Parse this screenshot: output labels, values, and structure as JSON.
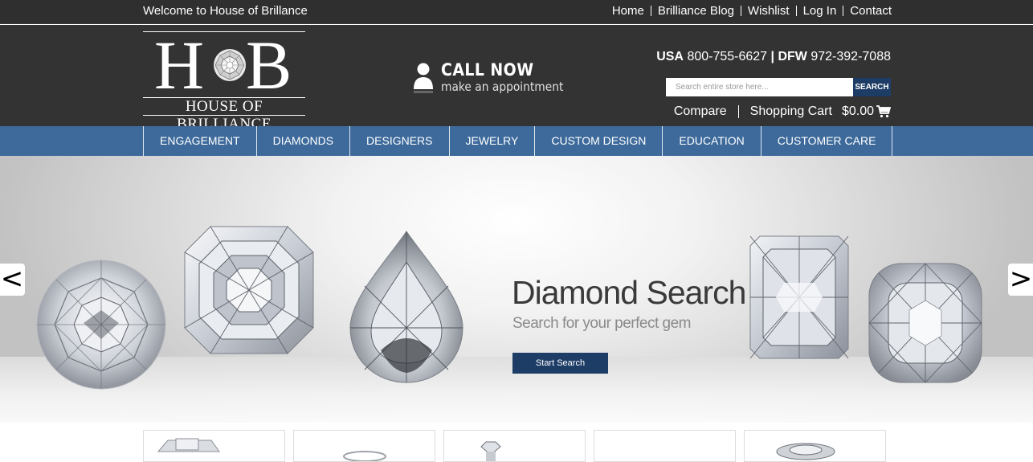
{
  "topbar": {
    "welcome": "Welcome to House of Brillance",
    "links": [
      "Home",
      "Brilliance Blog",
      "Wishlist",
      "Log In",
      "Contact"
    ]
  },
  "logo": {
    "letter_left": "H",
    "letter_right": "B",
    "wordmark": "HOUSE OF BRILLIANCE"
  },
  "callnow": {
    "title": "CALL NOW",
    "subtitle": "make an appointment",
    "icon": "person-icon"
  },
  "phones": {
    "usa_label": "USA",
    "usa_number": "800-755-6627",
    "separator": "|",
    "dfw_label": "DFW",
    "dfw_number": "972-392-7088"
  },
  "search": {
    "placeholder": "Search entire store here...",
    "button": "SEARCH"
  },
  "cartline": {
    "compare": "Compare",
    "cart": "Shopping Cart",
    "total": "$0.00",
    "icon": "cart-icon"
  },
  "nav": {
    "items": [
      "ENGAGEMENT",
      "DIAMONDS",
      "DESIGNERS",
      "JEWELRY",
      "CUSTOM DESIGN",
      "EDUCATION",
      "CUSTOMER CARE"
    ]
  },
  "hero": {
    "title": "Diamond Search",
    "subtitle": "Search for your perfect gem",
    "button": "Start Search",
    "prev": "<",
    "next": ">",
    "gems": [
      "round-diamond",
      "asscher-diamond",
      "pear-diamond",
      "radiant-diamond",
      "cushion-diamond"
    ]
  },
  "colors": {
    "topbar": "#2f2f2f",
    "header": "#333333",
    "nav": "#3d6a9b",
    "button": "#1e3d66"
  }
}
